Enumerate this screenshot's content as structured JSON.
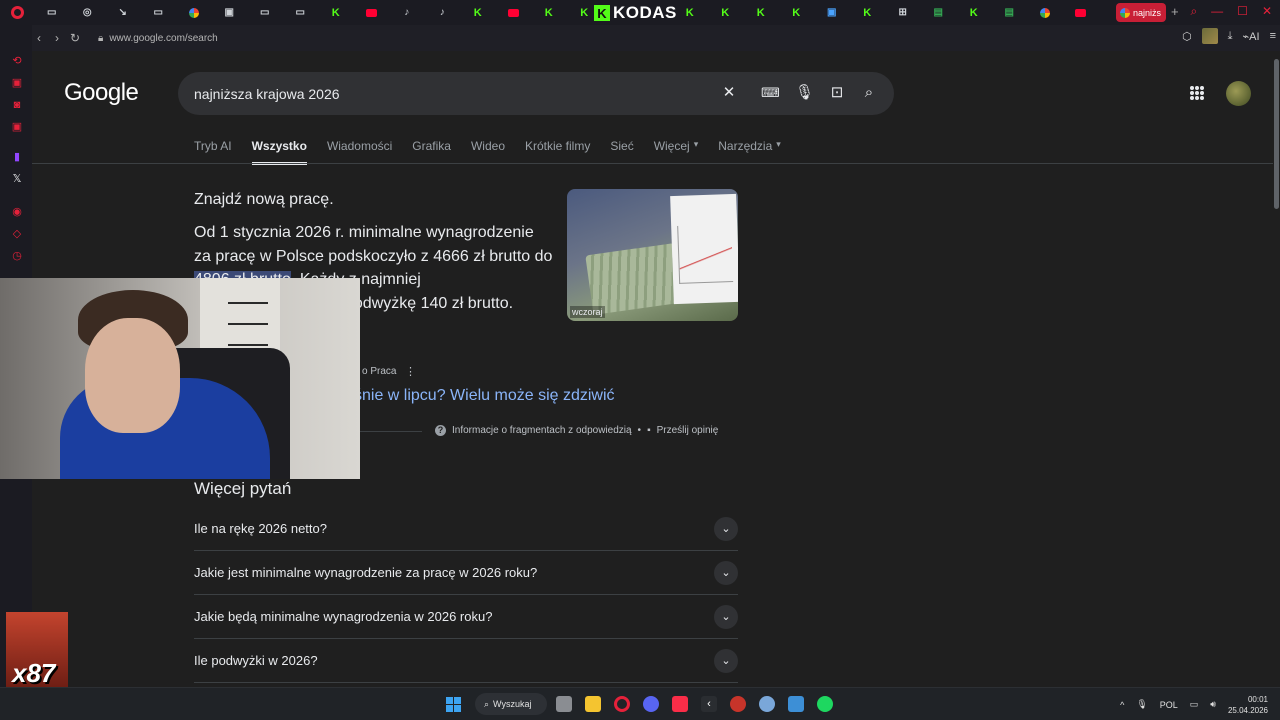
{
  "browser": {
    "brand_tab": "KODAS",
    "active_tab_label": "najniżs",
    "url": "www.google.com/search",
    "toolbar_ai_label": "AI"
  },
  "google": {
    "logo": "Google",
    "query": "najniższa krajowa 2026",
    "tabs": [
      "Tryb AI",
      "Wszystko",
      "Wiadomości",
      "Grafika",
      "Wideo",
      "Krótkie filmy",
      "Sieć",
      "Więcej",
      "Narzędzia"
    ],
    "active_tab": "Wszystko",
    "snippet": {
      "heading": "Znajdź nową pracę.",
      "text_before": "Od 1 stycznia 2026 r. minimalne wynagrodzenie za pracę w Polsce podskoczyło z 4666 zł brutto do ",
      "highlight": "4806 zł brutto",
      "text_after": ". Każdy z najmniej",
      "text_line4": "ł podwyżkę 140 zł brutto.",
      "image_date": "wczoraj"
    },
    "source": "o Praca",
    "result_link": "śnie w lipcu? Wielu może się zdziwić",
    "feedback": {
      "info_label": "Informacje o fragmentach z odpowiedzią",
      "send_label": "Prześlij opinię"
    },
    "paa": {
      "title": "Więcej pytań",
      "items": [
        "Ile na rękę 2026 netto?",
        "Jakie jest minimalne wynagrodzenie za pracę w 2026 roku?",
        "Jakie będą minimalne wynagrodzenia w 2026 roku?",
        "Ile podwyżki w 2026?"
      ]
    }
  },
  "overlay": {
    "sticker_text": "x87"
  },
  "taskbar": {
    "search_label": "Wyszukaj",
    "lang": "POL",
    "time": "00:01",
    "date": "25.04.2026"
  },
  "colors": {
    "accent_red": "#e5213a",
    "kick_green": "#53fc18",
    "link_blue": "#8ab4f8",
    "page_bg": "#1f1f1f"
  }
}
